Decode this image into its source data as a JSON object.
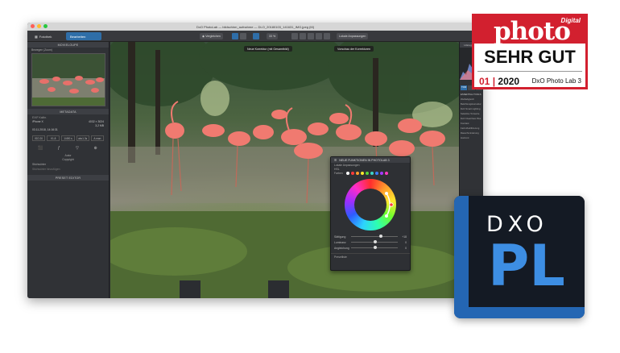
{
  "window": {
    "title": "DxO PhotoLab — bildschirm_aufnahme — DLO_20180103_141631_IMG.jpeg (M)"
  },
  "toolbar": {
    "library_label": "Fotothek",
    "customize_label": "Bearbeiten",
    "compare_label": "Vergleichen",
    "zoom_label": "33 %",
    "local_adjust_label": "Lokale Anpassungen"
  },
  "left_panel": {
    "loupe_header": "MOVIELOUPE",
    "loupe_tag": "Bewegen (Zoom)",
    "metadata_header": "METADATA",
    "exif_title": "EXIF Kalibr.",
    "rows": [
      {
        "label": "iPhone X",
        "value": "4032 × 3024"
      },
      {
        "label": "",
        "value": "3,2 MB"
      },
      {
        "label": "03.11.2018, 14:16:31",
        "value": ""
      }
    ],
    "exif_cells": [
      "ISO 20",
      "f/1.8",
      "1/490 s",
      "abc1.3s",
      "A man"
    ],
    "exif_icons": [
      "⬛",
      "ƒ",
      "▽",
      "⊕"
    ],
    "exif_icon_vals": [
      "",
      "",
      "",
      "ISO"
    ],
    "author_label": "Autor",
    "copyright_label": "Copyright",
    "keywords_label": "Stichwörter",
    "keywords_placeholder": "Stichwörter hinzufügen",
    "preset_header": "PRESET EDITOR"
  },
  "photo": {
    "btn_new_correction": "Neue Korrektur (mit Gesamtbild)",
    "btn_preview": "Vorschau der Korrekturen"
  },
  "hsl_panel": {
    "title": "NEUE FUNKTIONEN IN PHOTOLAB 3",
    "sub1": "Lokale Anpassungen",
    "sub2": "HSL",
    "colors_label": "Farben",
    "slider_sat": "Sättigung",
    "slider_lum": "Luminanz",
    "slider_unif": "Angleichung",
    "val_sat": "+18",
    "val_lum": "0",
    "val_unif": "0",
    "footer": "Presetliste",
    "swatch_colors": [
      "#ffffff",
      "#ff3b3b",
      "#ff9e2c",
      "#ffe82c",
      "#58d43b",
      "#3bd4c8",
      "#3b7dff",
      "#a43bff",
      "#ff3bc0"
    ]
  },
  "right_panel": {
    "histogram": "Histogramm",
    "tabs": [
      "TOR",
      "",
      ""
    ],
    "essential_tools": "ESSENTIAL TOOLS",
    "items": [
      "Weißabgleich",
      "Belichtungskorrektur",
      "DxO Smart Lighting",
      "Selektive Tonwerte",
      "DxO ClearView Plus",
      "Kontrast",
      "Farb-Modifizierung",
      "Rauschminderung",
      "Horizont"
    ]
  },
  "badge": {
    "magazine": "photo",
    "digital": "Digital",
    "rating": "SEHR GUT",
    "issue_num": "01",
    "issue_year": "2020",
    "product": "DxO Photo Lab 3"
  },
  "logo": {
    "top_text": "DXO",
    "main_text": "PL"
  },
  "colors": {
    "accent": "#2f6ea8",
    "badge_red": "#d2202f",
    "logo_blue": "#2466b3",
    "logo_dark": "#141a24"
  }
}
